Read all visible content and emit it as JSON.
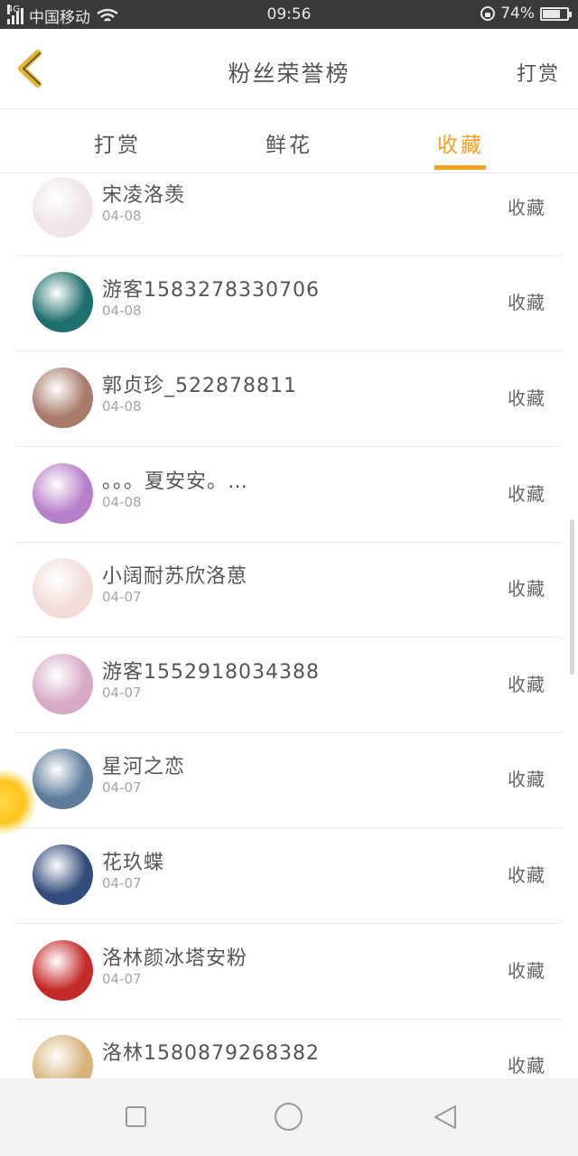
{
  "status_bar": {
    "network": "4G",
    "carrier": "中国移动",
    "time": "09:56",
    "battery": "74%",
    "battery_level": 0.74,
    "icons": [
      "signal-icon",
      "wifi-icon",
      "rotation-lock-icon",
      "battery-icon"
    ]
  },
  "header": {
    "title": "粉丝荣誉榜",
    "right_action": "打赏",
    "back_icon": "chevron-left-icon"
  },
  "tabs": [
    {
      "label": "打赏",
      "active": false
    },
    {
      "label": "鲜花",
      "active": false
    },
    {
      "label": "收藏",
      "active": true
    }
  ],
  "accent_color": "#f0a224",
  "fans": [
    {
      "name": "宋凌洛羡",
      "date": "04-08",
      "action": "收藏",
      "avatar_color": "#efe4e6"
    },
    {
      "name": "游客1583278330706",
      "date": "04-08",
      "action": "收藏",
      "avatar_color": "#1f6f6e"
    },
    {
      "name": "郭贞珍_522878811",
      "date": "04-08",
      "action": "收藏",
      "avatar_color": "#a77a6a"
    },
    {
      "name": "。。。夏安安。…",
      "date": "04-08",
      "action": "收藏",
      "avatar_color": "#b77fc9"
    },
    {
      "name": "小阔耐苏欣洛葸",
      "date": "04-07",
      "action": "收藏",
      "avatar_color": "#f1dcd8"
    },
    {
      "name": "游客1552918034388",
      "date": "04-07",
      "action": "收藏",
      "avatar_color": "#d7a9c7"
    },
    {
      "name": "星河之恋",
      "date": "04-07",
      "action": "收藏",
      "avatar_color": "#5d7b9a"
    },
    {
      "name": "花玖蝶",
      "date": "04-07",
      "action": "收藏",
      "avatar_color": "#334c7b"
    },
    {
      "name": "洛林颜冰塔安粉",
      "date": "04-07",
      "action": "收藏",
      "avatar_color": "#c52a2a"
    },
    {
      "name": "洛林1580879268382",
      "date": "",
      "action": "收藏",
      "avatar_color": "#d6b37a"
    }
  ],
  "nav_bar": {
    "icons": [
      "recent-apps-icon",
      "home-icon",
      "back-icon"
    ]
  }
}
